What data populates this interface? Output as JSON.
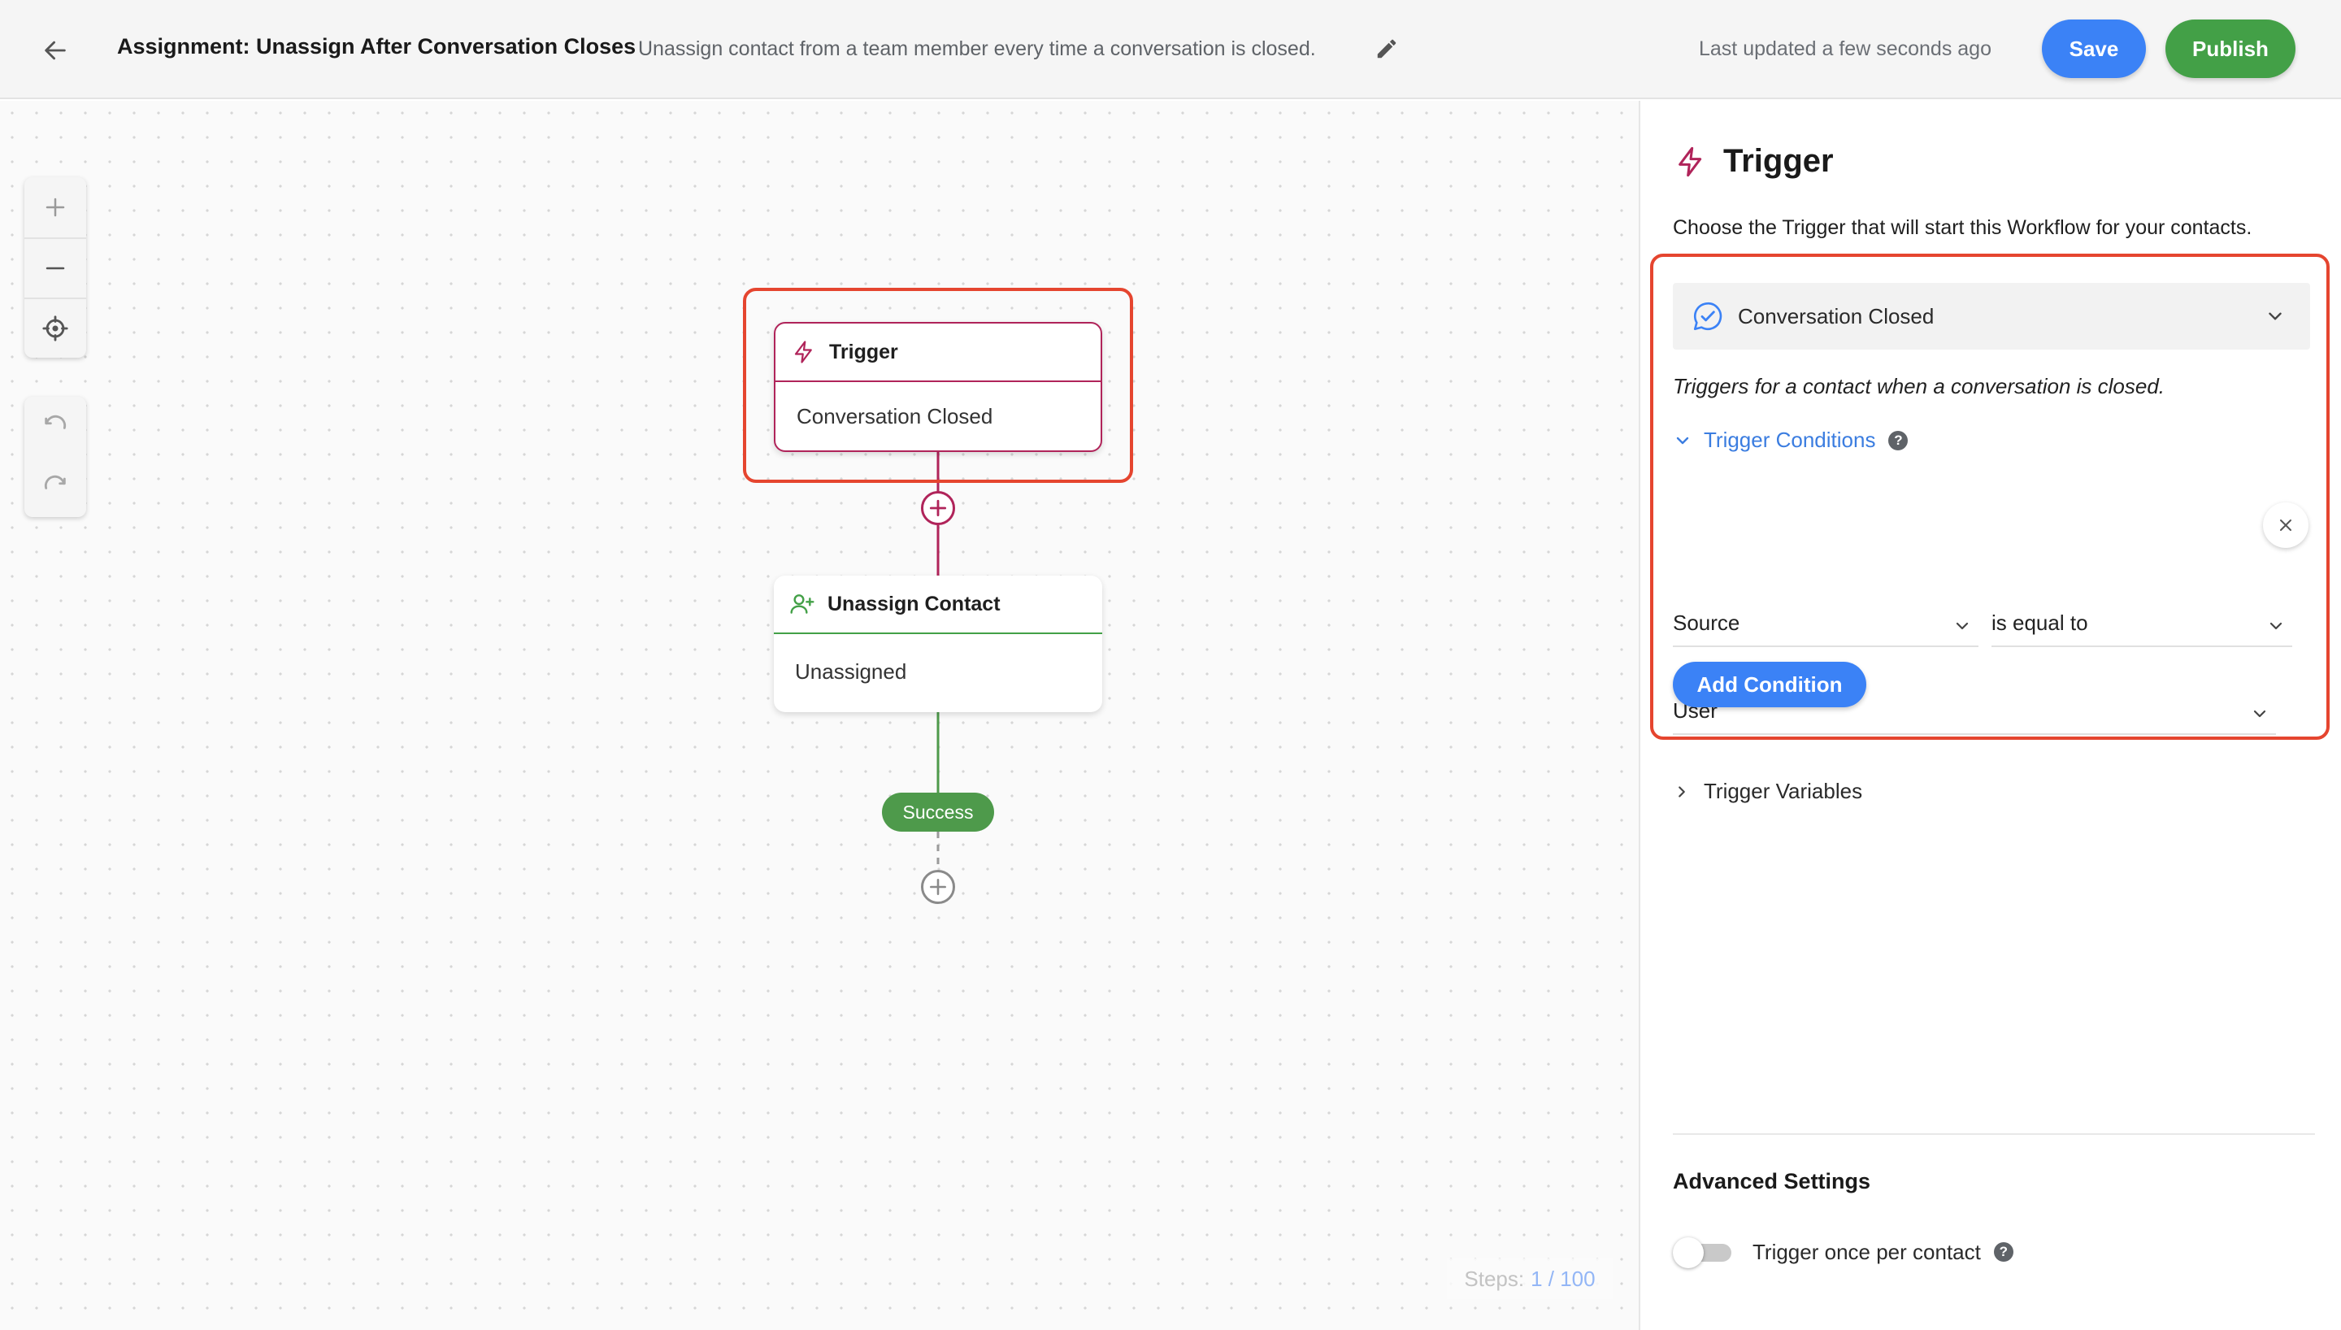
{
  "header": {
    "title": "Assignment: Unassign After Conversation Closes",
    "description": "Unassign contact from a team member every time a conversation is closed.",
    "last_updated": "Last updated a few seconds ago",
    "save_label": "Save",
    "publish_label": "Publish"
  },
  "canvas": {
    "tools": {
      "zoom_in": "plus-icon",
      "zoom_out": "minus-icon",
      "recenter": "crosshair-icon",
      "undo": "undo-icon",
      "redo": "redo-icon"
    },
    "nodes": {
      "trigger": {
        "title": "Trigger",
        "subtitle": "Conversation Closed",
        "icon": "lightning-bolt-icon"
      },
      "action": {
        "title": "Unassign Contact",
        "subtitle": "Unassigned",
        "icon": "user-plus-icon"
      }
    },
    "success_label": "Success",
    "steps": {
      "label": "Steps:",
      "count": "1 / 100"
    }
  },
  "panel": {
    "title": "Trigger",
    "subtitle": "Choose the Trigger that will start this Workflow for your contacts.",
    "selected_trigger": "Conversation Closed",
    "trigger_help": "Triggers for a contact when a conversation is closed.",
    "conditions_label": "Trigger Conditions",
    "condition": {
      "field": "Source",
      "operator": "is equal to",
      "value": "User"
    },
    "add_condition_label": "Add Condition",
    "variables_label": "Trigger Variables",
    "advanced_title": "Advanced Settings",
    "trigger_once_label": "Trigger once per contact",
    "trigger_once_enabled": false
  },
  "colors": {
    "primary": "#3b82f6",
    "publish": "#43a047",
    "trigger_accent": "#b0245a",
    "highlight": "#e5452f",
    "link": "#3b7de0"
  }
}
